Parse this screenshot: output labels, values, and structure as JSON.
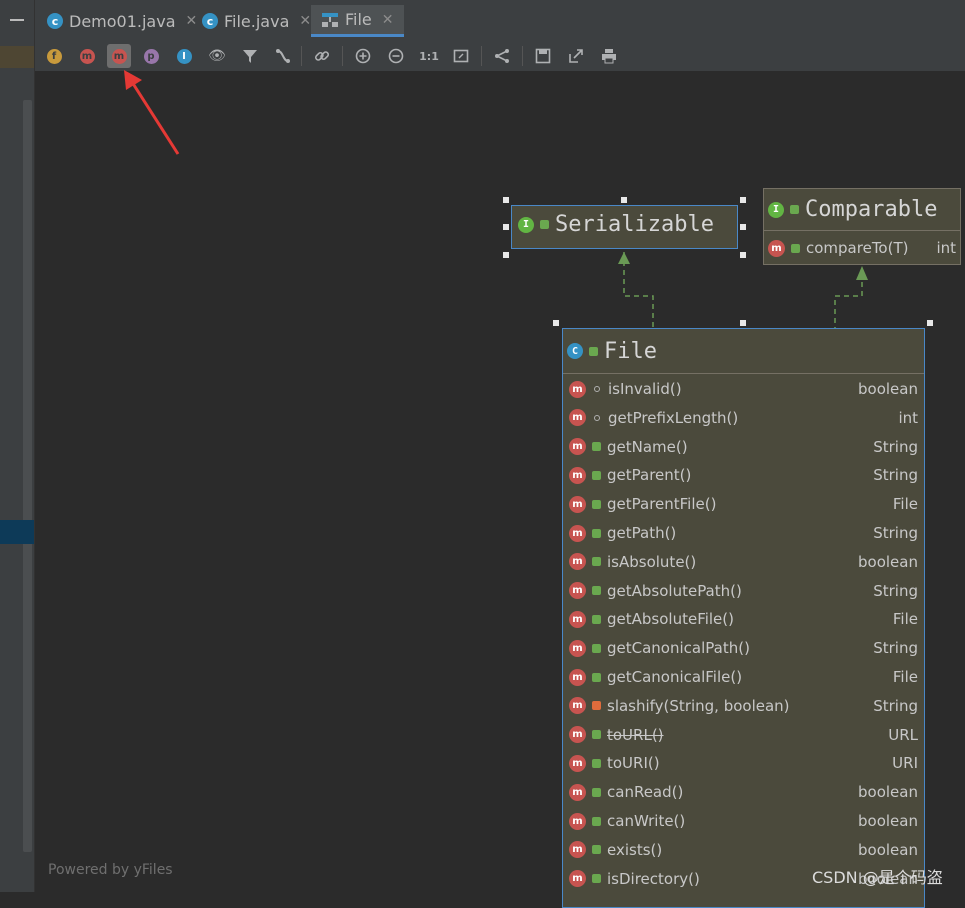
{
  "tabs": [
    {
      "label": "Demo01.java",
      "icon": "java-class-icon",
      "active": false
    },
    {
      "label": "File.java",
      "icon": "java-class-icon",
      "active": false
    },
    {
      "label": "File",
      "icon": "diagram-icon",
      "active": true
    }
  ],
  "toolbar": {
    "fields_glyph": "f",
    "constructors_glyph": "m",
    "methods_glyph": "m",
    "properties_glyph": "p",
    "inner_classes_glyph": "I",
    "actual_size_glyph": "1:1"
  },
  "nodes": {
    "serializable": {
      "name": "Serializable",
      "kind_glyph": "I"
    },
    "comparable": {
      "name": "Comparable",
      "kind_glyph": "I",
      "methods": [
        {
          "name": "compareTo(T)",
          "type": "int"
        }
      ]
    },
    "file": {
      "name": "File",
      "kind_glyph": "C",
      "methods": [
        {
          "name": "isInvalid()",
          "type": "boolean",
          "vis": "package"
        },
        {
          "name": "getPrefixLength()",
          "type": "int",
          "vis": "package"
        },
        {
          "name": "getName()",
          "type": "String",
          "vis": "public"
        },
        {
          "name": "getParent()",
          "type": "String",
          "vis": "public"
        },
        {
          "name": "getParentFile()",
          "type": "File",
          "vis": "public"
        },
        {
          "name": "getPath()",
          "type": "String",
          "vis": "public"
        },
        {
          "name": "isAbsolute()",
          "type": "boolean",
          "vis": "public"
        },
        {
          "name": "getAbsolutePath()",
          "type": "String",
          "vis": "public"
        },
        {
          "name": "getAbsoluteFile()",
          "type": "File",
          "vis": "public"
        },
        {
          "name": "getCanonicalPath()",
          "type": "String",
          "vis": "public"
        },
        {
          "name": "getCanonicalFile()",
          "type": "File",
          "vis": "public"
        },
        {
          "name": "slashify(String, boolean)",
          "type": "String",
          "vis": "private"
        },
        {
          "name": "toURL()",
          "type": "URL",
          "vis": "public",
          "deprecated": true
        },
        {
          "name": "toURI()",
          "type": "URI",
          "vis": "public"
        },
        {
          "name": "canRead()",
          "type": "boolean",
          "vis": "public"
        },
        {
          "name": "canWrite()",
          "type": "boolean",
          "vis": "public"
        },
        {
          "name": "exists()",
          "type": "boolean",
          "vis": "public"
        },
        {
          "name": "isDirectory()",
          "type": "boolean",
          "vis": "public"
        }
      ]
    }
  },
  "method_glyph": "m",
  "footer": "Powered by yFiles",
  "watermark": "CSDN @是个码盗",
  "colors": {
    "background": "#2b2b2b",
    "node_fill": "#4b4a3c",
    "selection": "#4a88c7",
    "method_icon": "#c75450",
    "interface_icon": "#62b543",
    "class_icon": "#3592c4",
    "arrow": "#e53935"
  }
}
